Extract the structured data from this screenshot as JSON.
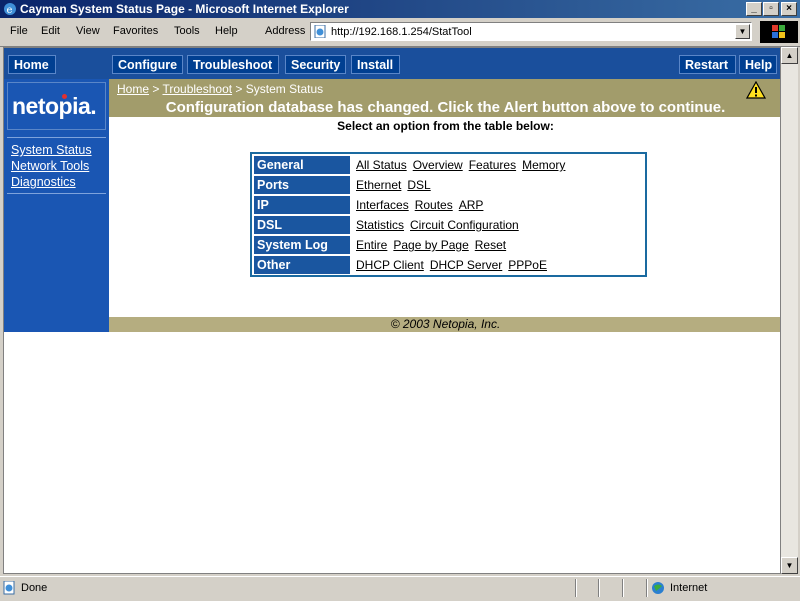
{
  "window": {
    "title": "Cayman System Status Page - Microsoft Internet Explorer",
    "controls": {
      "minimize": "_",
      "maximize": "▫",
      "close": "×"
    }
  },
  "menu": [
    "File",
    "Edit",
    "View",
    "Favorites",
    "Tools",
    "Help"
  ],
  "address": {
    "label": "Address",
    "url": "http://192.168.1.254/StatTool"
  },
  "nav": {
    "home": "Home",
    "configure": "Configure",
    "troubleshoot": "Troubleshoot",
    "security": "Security",
    "install": "Install",
    "restart": "Restart",
    "help": "Help"
  },
  "logo": {
    "text": "netopia."
  },
  "sidebar": {
    "items": [
      {
        "label": "System Status"
      },
      {
        "label": "Network Tools"
      },
      {
        "label": "Diagnostics"
      }
    ]
  },
  "breadcrumb": {
    "home": "Home",
    "sep": " > ",
    "troubleshoot": "Troubleshoot",
    "current": "System Status"
  },
  "alert": {
    "message": "Configuration database has changed. Click the Alert button above to continue."
  },
  "instruction": "Select an option from the table below:",
  "options": [
    {
      "category": "General",
      "links": [
        "All Status",
        "Overview",
        "Features",
        "Memory"
      ]
    },
    {
      "category": "Ports",
      "links": [
        "Ethernet",
        "DSL"
      ]
    },
    {
      "category": "IP",
      "links": [
        "Interfaces",
        "Routes",
        "ARP"
      ]
    },
    {
      "category": "DSL",
      "links": [
        "Statistics",
        "Circuit Configuration"
      ]
    },
    {
      "category": "System Log",
      "links": [
        "Entire",
        "Page by Page",
        "Reset"
      ]
    },
    {
      "category": "Other",
      "links": [
        "DHCP Client",
        "DHCP Server",
        "PPPoE"
      ]
    }
  ],
  "footer": "© 2003 Netopia, Inc.",
  "status": {
    "text": "Done",
    "zone": "Internet"
  },
  "colors": {
    "nav_blue": "#1a4f9c",
    "alert_band": "#a29c6b",
    "footer_band": "#b5ad80"
  }
}
